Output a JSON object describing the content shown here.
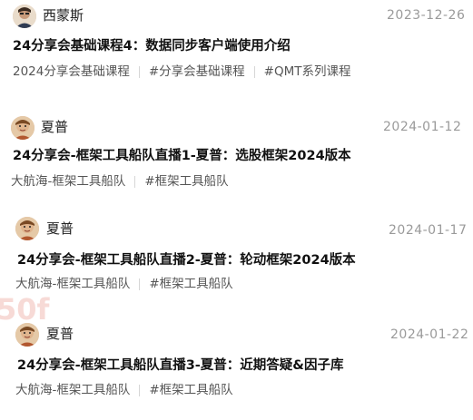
{
  "posts": [
    {
      "author": "西蒙斯",
      "date": "2023-12-26",
      "title": "24分享会基础课程4：数据同步客户端使用介绍",
      "tags": [
        "2024分享会基础课程",
        "#分享会基础课程",
        "#QMT系列课程"
      ]
    },
    {
      "author": "夏普",
      "date": "2024-01-12",
      "title": "24分享会-框架工具船队直播1-夏普：选股框架2024版本",
      "tags": [
        "大航海-框架工具船队",
        "#框架工具船队"
      ]
    },
    {
      "author": "夏普",
      "date": "2024-01-17",
      "title": "24分享会-框架工具船队直播2-夏普：轮动框架2024版本",
      "tags": [
        "大航海-框架工具船队",
        "#框架工具船队"
      ]
    },
    {
      "author": "夏普",
      "date": "2024-01-22",
      "title": "24分享会-框架工具船队直播3-夏普：近期答疑&因子库",
      "tags": [
        "大航海-框架工具船队",
        "#框架工具船队"
      ]
    }
  ],
  "watermark": "50f"
}
